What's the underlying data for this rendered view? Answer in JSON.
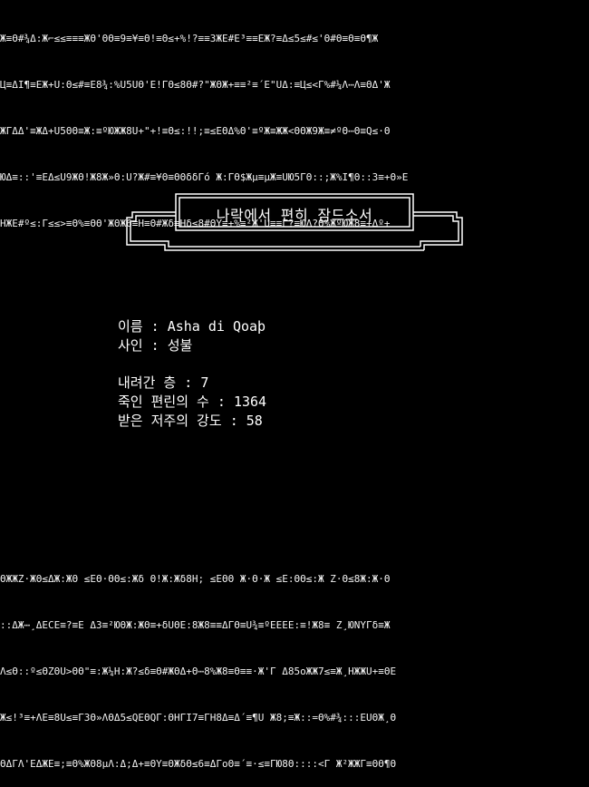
{
  "noise_top": [
    "Ж≡Θ#¾Δ:Ж⌐≤≤≡≡≡ЖΘ'ΘΘ≡9≡¥≡Θ!≡Θ≤+%!?≡≡ЗЖΕ#Ε³≡≡ΕЖ?≡Δ≤5≤#≤'Θ#Θ≡Θ≡Θ¶Ж",
    "Ц≡ΔI¶≡ЕЖ+U:Θ≤#≡Ε8¾:%U5UΘ'Ε!ΓΘ≤8Θ#?\"ЖΘЖ+≡≡²≡΄Ε\"UΔ:≡Ц≤<Γ%#¼Λ⋯Λ≡ΘΔ'Ж",
    "ЖΓΔΔ'≡ЖΔ+U5ΘΘ≡Ж:≡ºЮЖЖ8U+\"+!≡Θ≤:!!;≡≤ΕΘΔ%Θ'≡ºЖ≡ЖЖ<ΘΘЖ9Ж≡≠ºΘ⋯Θ≡Q≤·Θ",
    "ЮΔ≡::'≡ЕΔ≤U9ЖΘ!Ж8Ж»Θ:U?Ж#≡¥Θ≡ΘΘδδΓό Ж:ΓΘ$Жµ≡µЖ≡UЮ5ΓΘ::;Ж%I¶Θ::3≡+Θ»Ε",
    "НЖΕ#º≤:Γ≤≤>≡Θ%≡ΘΘ'ЖΘЖ6≡Н≡Θ#Жδ≡Нδ≤8#ΘΥ≡+%≡²Ж'U≡≡Γ?≡ЮΛ?Θ%ЖºЮЖ8≡+Δº+"
  ],
  "noise_bottom": [
    "ΘЖЖΖ·ЖΘ≤ΔЖ:ЖΘ ≤ΕΘ·ΘΘ≤:Жδ Θ!Ж:Жδ8Н; ≤ΕΘΘ Ж·Θ·Ж ≤Ε:ΘΘ≤:Ж Ζ·Θ≤8Ж:Ж·Θ",
    "::ΔЖ⋯¸ΔΕCΕ≡?≡Ε Δ3≡²ЮΘЖ:ЖΘ≡+δUΘΕ:8Ж8≡≡ΔΓΘ≡U¾≡ºΕΕΕΕ:≡!Ж8≡ Ζ¸ЮΝΥΓδ≡Ж",
    "Λ≤Θ::º≤ΘΖΘU>ΘΘ\"≡:Ж¼Н:Ж?≤δ≡Θ#ЖΘΔ+Θ⋯8%Ж8≡Θ≡≡·Ж'Γ Δ85οЖЖ7≤≡Ж¸НЖЖU+≡ΘΕ",
    "Ж≤!³≡+ΛΕ≡8U≤≡Γ3Θ»ΛΘΔ5≤QΕΘQΓ:ΘНΓI7≡ΓН8Δ≡Δ΄≡¶U Ж8;≡Ж::=Θ%#¾:::ΕUΘЖ¸Θ",
    "ΘΔΓΛ'ΕΔЖΕ≡;≡Θ%ЖΘ8µΛ:Δ;Δ+≡ΘΥ≡ΘЖδΘ≤6≡ΔΓοΘ≡΄≡·≤≡ΓЮ8Θ::::<Γ Ж²ЖЖΓ≡ΘΘ¶Θ"
  ],
  "banner": {
    "title": "나락에서 편히 잠드소서"
  },
  "stats": {
    "name_label": "이름",
    "name_value": "Asha di Qoaþ",
    "cause_label": "사인",
    "cause_value": "성불",
    "floor_label": "내려간 층",
    "floor_value": "7",
    "kills_label": "죽인 편린의 수",
    "kills_value": "1364",
    "curse_label": "받은 저주의 강도",
    "curse_value": "58"
  }
}
